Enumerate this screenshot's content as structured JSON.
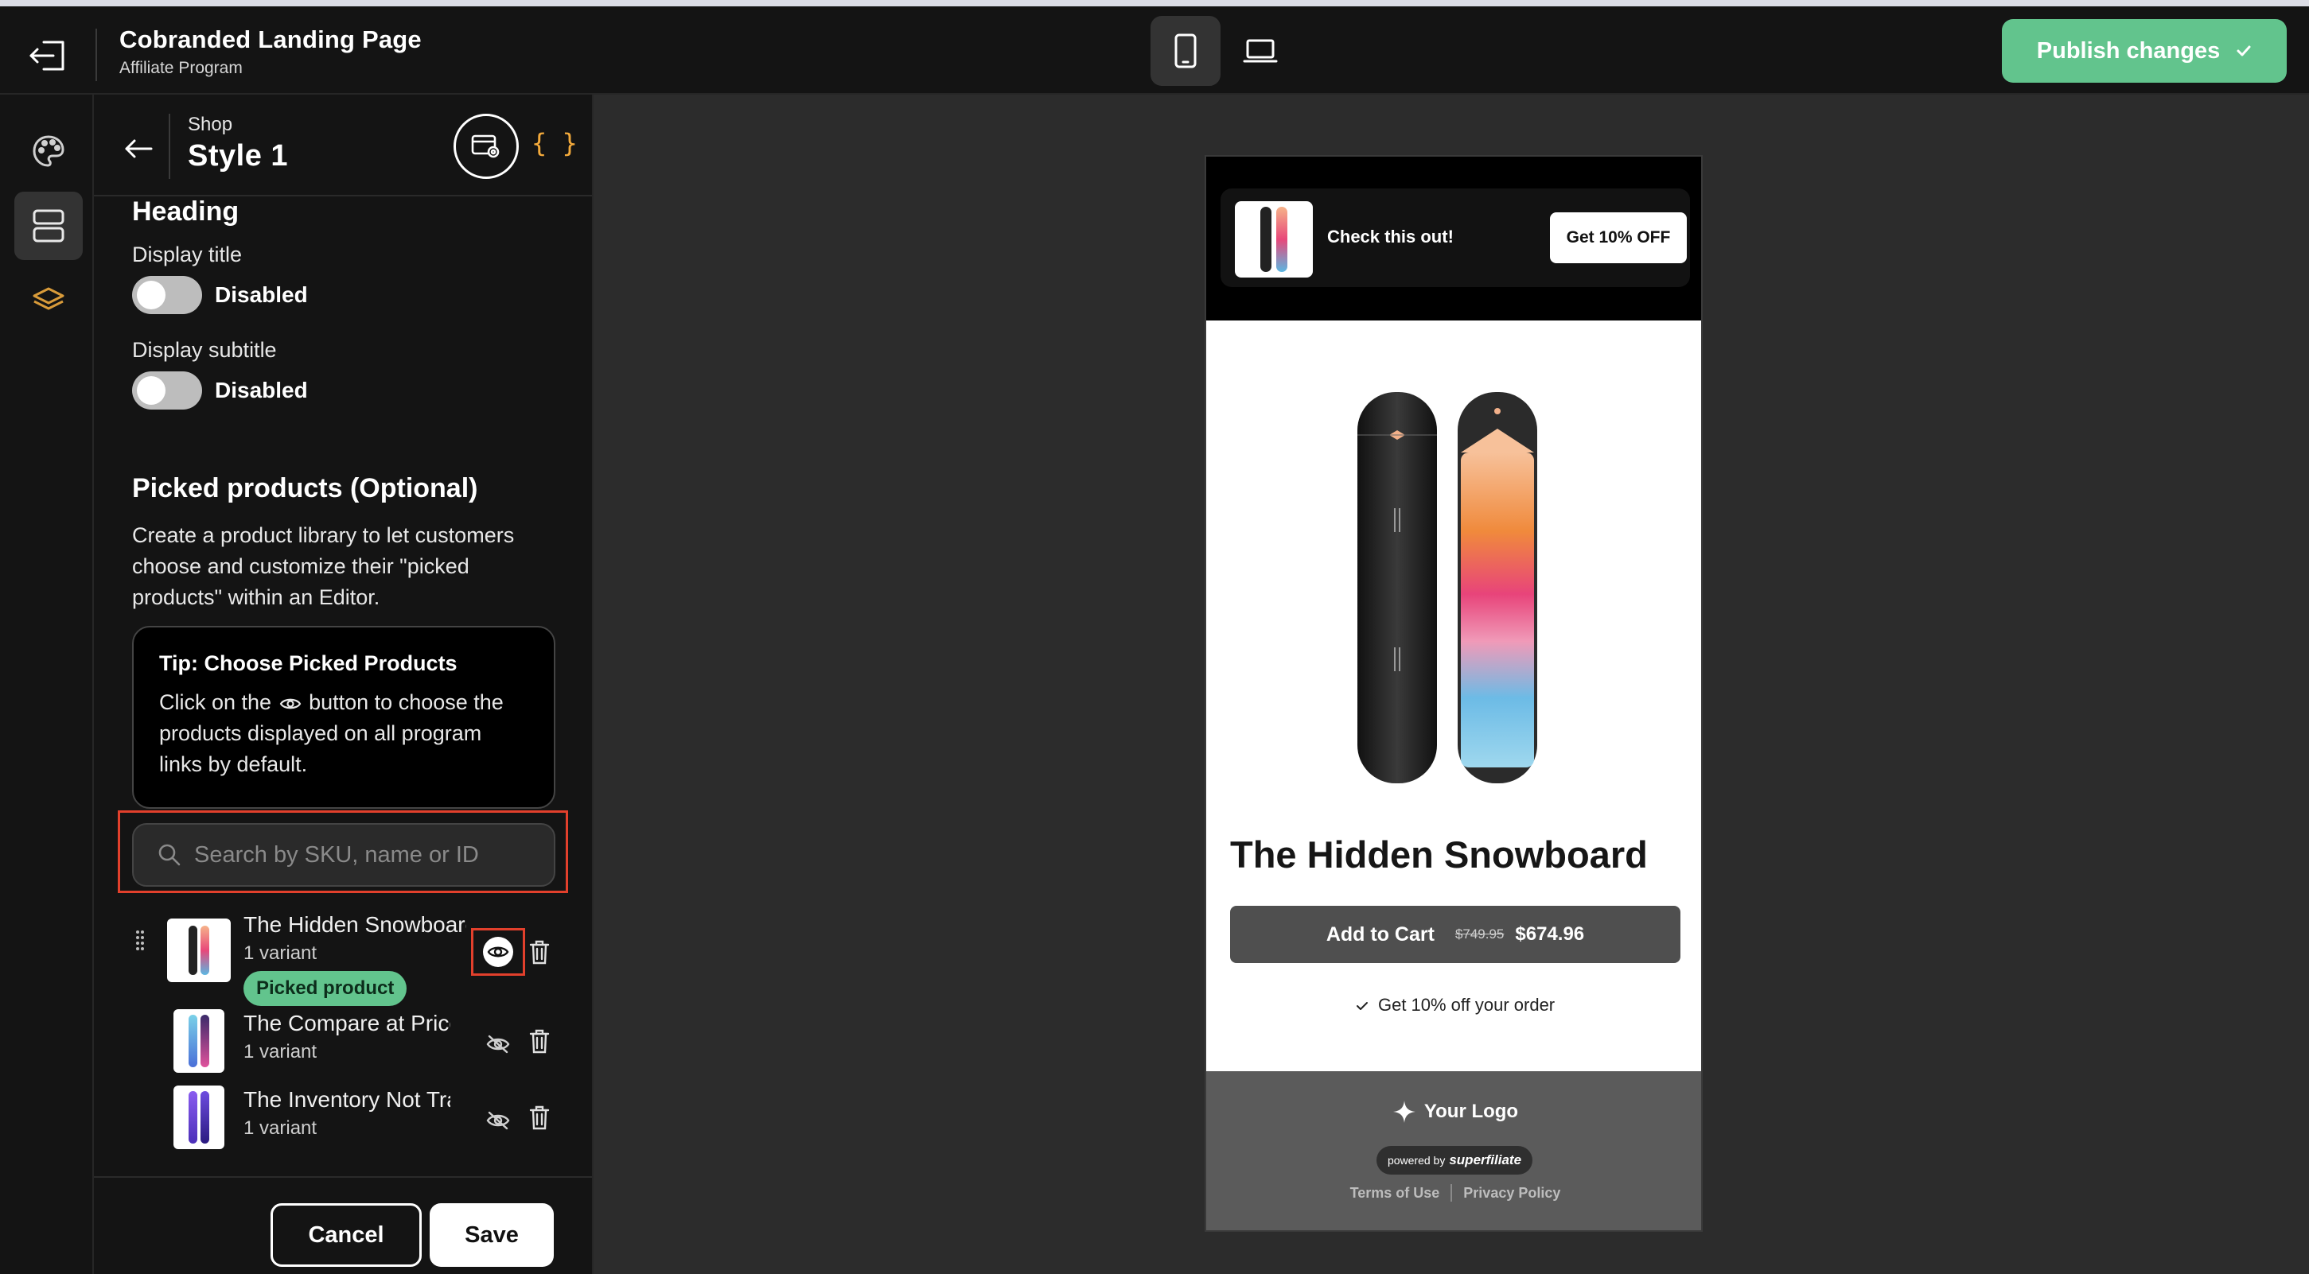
{
  "header": {
    "title": "Cobranded Landing Page",
    "subtitle": "Affiliate Program",
    "publish_label": "Publish changes"
  },
  "panel": {
    "section_name": "Shop",
    "style_name": "Style 1",
    "code_label": "{ }",
    "heading_title": "Heading",
    "display_title_label": "Display title",
    "display_title_state": "Disabled",
    "display_subtitle_label": "Display subtitle",
    "display_subtitle_state": "Disabled",
    "picked_title": "Picked products (Optional)",
    "picked_desc": "Create a product library to let customers choose and customize their \"picked products\" within an Editor.",
    "tip": {
      "title": "Tip: Choose Picked Products",
      "body_before": "Click on the",
      "body_after": "button to choose the products displayed on all program links by default."
    },
    "search_placeholder": "Search by SKU, name or ID",
    "products": [
      {
        "name": "The Hidden Snowboard",
        "variants": "1 variant",
        "badge": "Picked product",
        "visible": true
      },
      {
        "name": "The Compare at Price Snowboard",
        "variants": "1 variant",
        "visible": false
      },
      {
        "name": "The Inventory Not Tracked Snowboard",
        "variants": "1 variant",
        "visible": false
      }
    ],
    "cancel_label": "Cancel",
    "save_label": "Save"
  },
  "preview": {
    "promo_text": "Check this out!",
    "promo_button": "Get 10% OFF",
    "product_title": "The Hidden Snowboard",
    "add_to_cart": "Add to Cart",
    "compare_price": "$749.95",
    "price": "$674.96",
    "discount_note": "Get 10% off your order",
    "logo_text": "Your Logo",
    "powered_by": "powered by",
    "powered_brand": "superfiliate",
    "terms": "Terms of Use",
    "privacy": "Privacy Policy"
  },
  "colors": {
    "accent_green": "#62c48d",
    "highlight_red": "#e2402c",
    "code_orange": "#f2a93b"
  },
  "icons": [
    "exit-icon",
    "mobile-icon",
    "desktop-icon",
    "check-icon",
    "palette-icon",
    "sections-icon",
    "layers-icon",
    "back-arrow-icon",
    "template-settings-icon",
    "search-icon",
    "drag-handle-icon",
    "eye-icon",
    "eye-off-icon",
    "trash-icon",
    "sparkle-icon",
    "checkmark-icon"
  ]
}
